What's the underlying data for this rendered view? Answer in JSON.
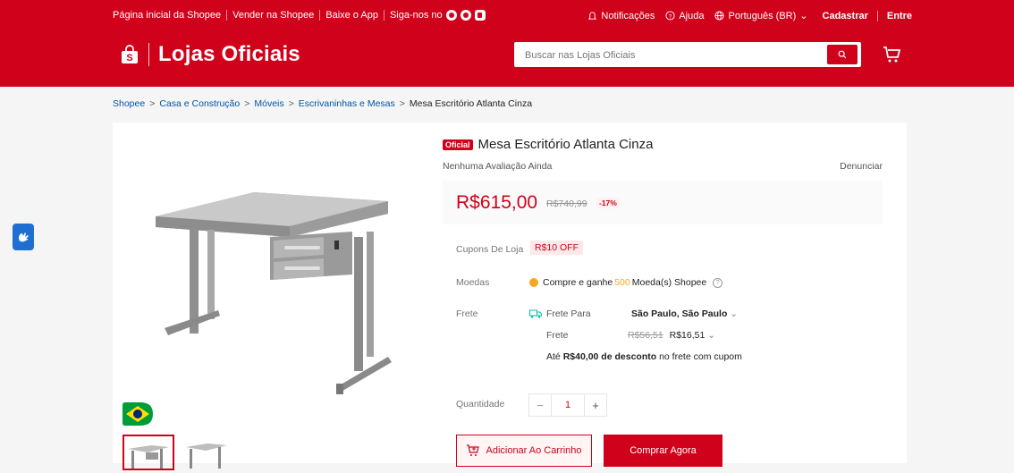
{
  "topbar": {
    "home": "Página inicial da Shopee",
    "seller": "Vender na Shopee",
    "app": "Baixe o App",
    "follow": "Siga-nos no",
    "notifications": "Notificações",
    "help": "Ajuda",
    "language": "Português (BR)",
    "signup": "Cadastrar",
    "login": "Entre"
  },
  "header": {
    "title": "Lojas Oficiais",
    "search_placeholder": "Buscar nas Lojas Oficiais"
  },
  "breadcrumb": {
    "items": [
      "Shopee",
      "Casa e Construção",
      "Móveis",
      "Escrivaninhas e Mesas"
    ],
    "current": "Mesa Escritório Atlanta Cinza"
  },
  "product": {
    "badge": "Oficial",
    "title": "Mesa Escritório Atlanta Cinza",
    "reviews": "Nenhuma Avaliação Ainda",
    "report": "Denunciar",
    "price": "R$615,00",
    "old_price": "R$740,99",
    "discount": "-17%",
    "coupons_label": "Cupons De Loja",
    "coupon": "R$10 OFF",
    "coins_label": "Moedas",
    "coins_pre": "Compre e ganhe",
    "coins_amount": "500",
    "coins_post": "Moeda(s) Shopee",
    "shipping_label": "Frete",
    "shipping_to": "Frete Para",
    "destination": "São Paulo, São Paulo",
    "freight_label": "Frete",
    "freight_old": "R$56,51",
    "freight_new": "R$16,51",
    "freight_discount_pre": "Até",
    "freight_discount_bold": "R$40,00 de desconto",
    "freight_discount_post": "no frete com cupom",
    "quantity_label": "Quantidade",
    "quantity": "1",
    "add_to_cart": "Adicionar Ao Carrinho",
    "buy_now": "Comprar Agora"
  },
  "colors": {
    "brand": "#d0011b",
    "coin": "#f5a623",
    "link": "#0055aa"
  }
}
